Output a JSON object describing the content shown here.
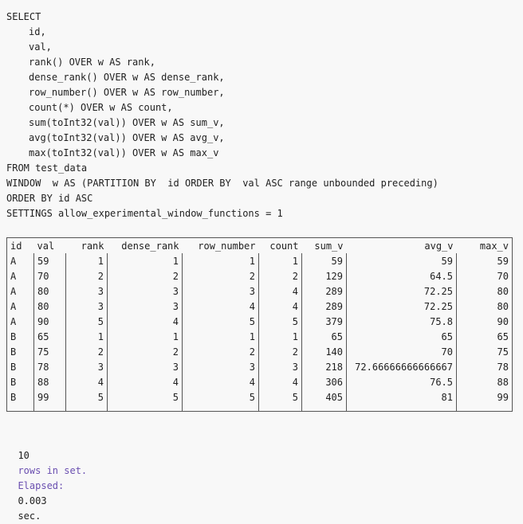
{
  "sql": {
    "lines": [
      {
        "text": "SELECT",
        "indent": false
      },
      {
        "text": "id,",
        "indent": true
      },
      {
        "text": "val,",
        "indent": true
      },
      {
        "text": "rank() OVER w AS rank,",
        "indent": true
      },
      {
        "text": "dense_rank() OVER w AS dense_rank,",
        "indent": true
      },
      {
        "text": "row_number() OVER w AS row_number,",
        "indent": true
      },
      {
        "text": "count(*) OVER w AS count,",
        "indent": true
      },
      {
        "text": "sum(toInt32(val)) OVER w AS sum_v,",
        "indent": true
      },
      {
        "text": "avg(toInt32(val)) OVER w AS avg_v,",
        "indent": true
      },
      {
        "text": "max(toInt32(val)) OVER w AS max_v",
        "indent": true
      },
      {
        "text": "FROM test_data",
        "indent": false
      },
      {
        "text": "WINDOW  w AS (PARTITION BY  id ORDER BY  val ASC range unbounded preceding)",
        "indent": false
      },
      {
        "text": "ORDER BY id ASC",
        "indent": false
      },
      {
        "text": "SETTINGS allow_experimental_window_functions = 1",
        "indent": false
      }
    ]
  },
  "result": {
    "columns": [
      {
        "name": "id",
        "align": "left"
      },
      {
        "name": "val",
        "align": "left"
      },
      {
        "name": "rank",
        "align": "right"
      },
      {
        "name": "dense_rank",
        "align": "right"
      },
      {
        "name": "row_number",
        "align": "right"
      },
      {
        "name": "count",
        "align": "right"
      },
      {
        "name": "sum_v",
        "align": "right"
      },
      {
        "name": "avg_v",
        "align": "right"
      },
      {
        "name": "max_v",
        "align": "right"
      }
    ],
    "rows": [
      [
        "A",
        "59",
        "1",
        "1",
        "1",
        "1",
        "59",
        "59",
        "59"
      ],
      [
        "A",
        "70",
        "2",
        "2",
        "2",
        "2",
        "129",
        "64.5",
        "70"
      ],
      [
        "A",
        "80",
        "3",
        "3",
        "3",
        "4",
        "289",
        "72.25",
        "80"
      ],
      [
        "A",
        "80",
        "3",
        "3",
        "4",
        "4",
        "289",
        "72.25",
        "80"
      ],
      [
        "A",
        "90",
        "5",
        "4",
        "5",
        "5",
        "379",
        "75.8",
        "90"
      ],
      [
        "B",
        "65",
        "1",
        "1",
        "1",
        "1",
        "65",
        "65",
        "65"
      ],
      [
        "B",
        "75",
        "2",
        "2",
        "2",
        "2",
        "140",
        "70",
        "75"
      ],
      [
        "B",
        "78",
        "3",
        "3",
        "3",
        "3",
        "218",
        "72.66666666666667",
        "78"
      ],
      [
        "B",
        "88",
        "4",
        "4",
        "4",
        "4",
        "306",
        "76.5",
        "88"
      ],
      [
        "B",
        "99",
        "5",
        "5",
        "5",
        "5",
        "405",
        "81",
        "99"
      ]
    ]
  },
  "status": {
    "count": "10",
    "rows_in_set": "rows in set.",
    "elapsed_label": "Elapsed:",
    "elapsed_value": "0.003",
    "unit": "sec."
  }
}
